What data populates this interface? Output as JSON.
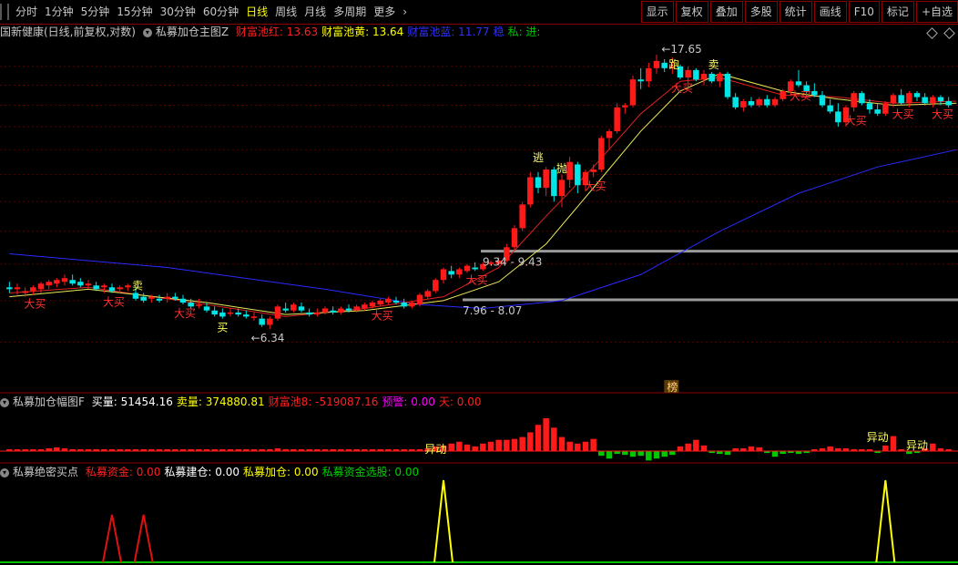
{
  "toolbar": {
    "periods": [
      "分时",
      "1分钟",
      "5分钟",
      "15分钟",
      "30分钟",
      "60分钟",
      "日线",
      "周线",
      "月线",
      "多周期",
      "更多"
    ],
    "active_period": "日线",
    "more_arrow": "›",
    "right_buttons": [
      "显示",
      "复权",
      "叠加",
      "多股",
      "统计",
      "画线",
      "F10",
      "标记",
      "+自选"
    ]
  },
  "main_panel": {
    "stock_title": "国新健康(日线,前复权,对数)",
    "indicator_name": "私募加仓主图Z",
    "legend": [
      {
        "label": "财富池红: 13.63",
        "color": "#ff2020"
      },
      {
        "label": "财富池黄: 13.64",
        "color": "#ffff00"
      },
      {
        "label": "财富池蓝: 11.77",
        "color": "#3030ff"
      },
      {
        "label": "稳",
        "color": "#3030ff"
      },
      {
        "label": "私: 进:",
        "color": "#00c000"
      }
    ]
  },
  "chart_data": {
    "type": "candlestick",
    "annotations": {
      "high_label": "17.65",
      "low_label": "6.34",
      "zone_upper": "9.34 - 9.43",
      "zone_lower": "7.96 - 8.07",
      "big_buy": "大买",
      "run": "跑",
      "sell": "卖",
      "escape": "逃",
      "throw": "抛",
      "rank": "榜",
      "buy_text": "买"
    },
    "candles": [
      [
        8.35,
        8.5,
        8.2,
        8.3
      ],
      [
        8.3,
        8.45,
        8.15,
        8.35
      ],
      [
        8.2,
        8.35,
        8.1,
        8.25
      ],
      [
        8.25,
        8.4,
        8.15,
        8.35
      ],
      [
        8.3,
        8.5,
        8.2,
        8.45
      ],
      [
        8.4,
        8.55,
        8.3,
        8.5
      ],
      [
        8.45,
        8.6,
        8.35,
        8.55
      ],
      [
        8.5,
        8.7,
        8.4,
        8.6
      ],
      [
        8.55,
        8.7,
        8.4,
        8.45
      ],
      [
        8.5,
        8.6,
        8.35,
        8.4
      ],
      [
        8.4,
        8.55,
        8.3,
        8.45
      ],
      [
        8.4,
        8.5,
        8.25,
        8.3
      ],
      [
        8.35,
        8.45,
        8.2,
        8.4
      ],
      [
        8.35,
        8.45,
        8.2,
        8.25
      ],
      [
        8.3,
        8.4,
        8.2,
        8.35
      ],
      [
        8.35,
        8.45,
        8.25,
        8.4
      ],
      [
        8.2,
        8.35,
        8.0,
        8.05
      ],
      [
        8.1,
        8.2,
        7.95,
        8.0
      ],
      [
        8.05,
        8.15,
        7.95,
        8.1
      ],
      [
        8.05,
        8.15,
        7.95,
        8.0
      ],
      [
        8.05,
        8.2,
        7.95,
        8.1
      ],
      [
        8.1,
        8.2,
        8.0,
        8.05
      ],
      [
        8.05,
        8.15,
        7.9,
        7.95
      ],
      [
        7.95,
        8.05,
        7.8,
        7.85
      ],
      [
        7.9,
        8.05,
        7.8,
        7.9
      ],
      [
        7.85,
        7.95,
        7.7,
        7.75
      ],
      [
        7.75,
        7.85,
        7.6,
        7.65
      ],
      [
        7.7,
        7.8,
        7.55,
        7.6
      ],
      [
        7.7,
        7.8,
        7.6,
        7.7
      ],
      [
        7.7,
        7.8,
        7.6,
        7.65
      ],
      [
        7.65,
        7.75,
        7.55,
        7.6
      ],
      [
        7.6,
        7.7,
        7.5,
        7.6
      ],
      [
        7.55,
        7.65,
        7.35,
        7.4
      ],
      [
        7.4,
        7.6,
        7.3,
        7.55
      ],
      [
        7.55,
        7.9,
        7.5,
        7.85
      ],
      [
        7.8,
        7.95,
        7.7,
        7.75
      ],
      [
        7.75,
        7.95,
        7.7,
        7.9
      ],
      [
        7.85,
        7.95,
        7.7,
        7.75
      ],
      [
        7.7,
        7.8,
        7.6,
        7.65
      ],
      [
        7.65,
        7.8,
        7.6,
        7.7
      ],
      [
        7.7,
        7.85,
        7.65,
        7.8
      ],
      [
        7.75,
        7.85,
        7.65,
        7.7
      ],
      [
        7.7,
        7.85,
        7.65,
        7.8
      ],
      [
        7.8,
        7.9,
        7.7,
        7.75
      ],
      [
        7.75,
        7.9,
        7.7,
        7.85
      ],
      [
        7.8,
        7.95,
        7.75,
        7.9
      ],
      [
        7.85,
        8.0,
        7.8,
        7.95
      ],
      [
        7.9,
        8.05,
        7.85,
        8.0
      ],
      [
        7.95,
        8.1,
        7.9,
        8.05
      ],
      [
        8.0,
        8.1,
        7.9,
        7.95
      ],
      [
        7.95,
        8.05,
        7.8,
        7.85
      ],
      [
        7.85,
        8.0,
        7.8,
        7.95
      ],
      [
        7.9,
        8.2,
        7.85,
        8.15
      ],
      [
        8.1,
        8.3,
        8.05,
        8.25
      ],
      [
        8.25,
        8.6,
        8.2,
        8.55
      ],
      [
        8.55,
        8.9,
        8.45,
        8.85
      ],
      [
        8.8,
        8.95,
        8.6,
        8.7
      ],
      [
        8.7,
        8.9,
        8.6,
        8.85
      ],
      [
        8.8,
        9.0,
        8.75,
        8.95
      ],
      [
        8.9,
        9.05,
        8.8,
        8.85
      ],
      [
        8.85,
        9.05,
        8.8,
        9.0
      ],
      [
        9.0,
        9.1,
        8.95,
        9.05
      ],
      [
        9.0,
        9.2,
        8.95,
        9.1
      ],
      [
        9.1,
        9.6,
        9.05,
        9.5
      ],
      [
        9.5,
        10.2,
        9.4,
        10.1
      ],
      [
        10.1,
        11.0,
        10.0,
        10.9
      ],
      [
        10.9,
        12.1,
        10.8,
        11.9
      ],
      [
        11.9,
        12.1,
        11.3,
        11.5
      ],
      [
        11.5,
        12.3,
        11.2,
        12.2
      ],
      [
        12.2,
        12.3,
        11.0,
        11.2
      ],
      [
        11.2,
        12.0,
        10.8,
        11.8
      ],
      [
        11.8,
        12.7,
        11.5,
        12.5
      ],
      [
        12.4,
        12.5,
        11.3,
        11.6
      ],
      [
        11.6,
        12.2,
        11.4,
        12.1
      ],
      [
        12.1,
        12.4,
        11.9,
        12.2
      ],
      [
        12.2,
        13.6,
        12.1,
        13.5
      ],
      [
        13.5,
        13.9,
        13.0,
        13.8
      ],
      [
        13.8,
        15.1,
        13.7,
        14.9
      ],
      [
        14.9,
        15.1,
        14.6,
        15.0
      ],
      [
        15.0,
        16.5,
        14.9,
        16.3
      ],
      [
        16.3,
        16.9,
        15.8,
        16.2
      ],
      [
        16.2,
        17.2,
        15.9,
        16.9
      ],
      [
        16.9,
        17.65,
        16.6,
        17.3
      ],
      [
        17.2,
        17.4,
        16.7,
        16.9
      ],
      [
        16.9,
        17.5,
        16.6,
        17.0
      ],
      [
        17.0,
        17.1,
        16.3,
        16.4
      ],
      [
        16.4,
        17.0,
        16.1,
        16.8
      ],
      [
        16.8,
        16.9,
        16.2,
        16.3
      ],
      [
        16.3,
        16.8,
        16.0,
        16.6
      ],
      [
        16.6,
        16.7,
        16.1,
        16.2
      ],
      [
        16.2,
        16.7,
        15.9,
        16.6
      ],
      [
        16.6,
        16.7,
        15.3,
        15.4
      ],
      [
        15.4,
        15.6,
        14.8,
        14.9
      ],
      [
        14.9,
        15.3,
        14.7,
        15.2
      ],
      [
        15.2,
        15.4,
        14.9,
        15.0
      ],
      [
        15.0,
        15.4,
        14.9,
        15.3
      ],
      [
        15.3,
        15.5,
        14.9,
        15.0
      ],
      [
        15.0,
        15.4,
        14.9,
        15.3
      ],
      [
        15.3,
        15.8,
        15.2,
        15.7
      ],
      [
        15.7,
        16.3,
        15.5,
        16.2
      ],
      [
        16.2,
        16.8,
        15.9,
        16.0
      ],
      [
        16.0,
        16.2,
        15.6,
        15.7
      ],
      [
        15.7,
        16.1,
        15.4,
        15.5
      ],
      [
        15.5,
        15.7,
        14.9,
        15.0
      ],
      [
        15.0,
        15.3,
        14.6,
        14.7
      ],
      [
        14.7,
        15.1,
        14.0,
        14.2
      ],
      [
        14.2,
        15.0,
        14.0,
        14.9
      ],
      [
        14.9,
        15.7,
        14.7,
        15.6
      ],
      [
        15.6,
        15.7,
        15.0,
        15.1
      ],
      [
        15.1,
        15.3,
        14.6,
        14.8
      ],
      [
        14.8,
        15.1,
        14.5,
        14.6
      ],
      [
        14.6,
        15.2,
        14.5,
        15.1
      ],
      [
        15.1,
        15.6,
        14.9,
        15.5
      ],
      [
        15.5,
        15.8,
        15.0,
        15.1
      ],
      [
        15.1,
        15.7,
        14.9,
        15.6
      ],
      [
        15.6,
        15.7,
        15.2,
        15.4
      ],
      [
        15.4,
        15.6,
        15.0,
        15.1
      ],
      [
        15.1,
        15.5,
        14.9,
        15.4
      ],
      [
        15.4,
        15.5,
        15.0,
        15.2
      ],
      [
        15.2,
        15.4,
        14.9,
        15.0
      ]
    ],
    "ma_blue_points": [
      [
        0,
        9.3
      ],
      [
        20,
        8.9
      ],
      [
        40,
        8.3
      ],
      [
        52,
        7.9
      ],
      [
        60,
        7.8
      ],
      [
        70,
        8.0
      ],
      [
        80,
        8.7
      ],
      [
        90,
        10.0
      ],
      [
        100,
        11.3
      ],
      [
        110,
        12.3
      ],
      [
        120,
        13.0
      ]
    ],
    "ma_red_points": [
      [
        0,
        8.2
      ],
      [
        10,
        8.35
      ],
      [
        25,
        7.9
      ],
      [
        35,
        7.6
      ],
      [
        45,
        7.8
      ],
      [
        55,
        8.1
      ],
      [
        62,
        8.9
      ],
      [
        68,
        10.5
      ],
      [
        74,
        12.3
      ],
      [
        80,
        14.6
      ],
      [
        85,
        16.2
      ],
      [
        90,
        16.4
      ],
      [
        98,
        15.5
      ],
      [
        105,
        15.4
      ],
      [
        112,
        15.1
      ],
      [
        120,
        15.2
      ]
    ],
    "ma_yellow_points": [
      [
        0,
        8.1
      ],
      [
        10,
        8.3
      ],
      [
        25,
        7.95
      ],
      [
        35,
        7.65
      ],
      [
        45,
        7.75
      ],
      [
        55,
        8.0
      ],
      [
        62,
        8.5
      ],
      [
        68,
        9.6
      ],
      [
        74,
        11.5
      ],
      [
        80,
        13.8
      ],
      [
        85,
        15.7
      ],
      [
        90,
        16.6
      ],
      [
        98,
        15.7
      ],
      [
        105,
        15.3
      ],
      [
        112,
        15.0
      ],
      [
        120,
        15.1
      ]
    ],
    "volume_panel": {
      "title": "私募加仓幅图F",
      "legend": [
        {
          "label": "买量: 51454.16",
          "color": "#ffffff"
        },
        {
          "label": "卖量: 374880.81",
          "color": "#ffff00"
        },
        {
          "label": "财富池8: -519087.16",
          "color": "#ff2020"
        },
        {
          "label": "预警: 0.00",
          "color": "#ff00ff"
        },
        {
          "label": "天: 0.00",
          "color": "#ff2020"
        }
      ],
      "marker": "异动",
      "values": [
        0.2,
        0.2,
        0.2,
        0.2,
        0.2,
        0.3,
        0.4,
        0.3,
        0.2,
        0.2,
        0.2,
        0.2,
        0.2,
        0.2,
        0.2,
        0.2,
        0.2,
        0.2,
        0.2,
        0.2,
        0.2,
        0.2,
        0.2,
        0.2,
        0.2,
        0.2,
        0.2,
        0.2,
        0.2,
        0.2,
        0.2,
        0.2,
        0.2,
        0.2,
        0.3,
        0.2,
        0.2,
        0.2,
        0.2,
        0.2,
        0.2,
        0.2,
        0.2,
        0.2,
        0.2,
        0.2,
        0.2,
        0.2,
        0.2,
        0.2,
        0.2,
        0.2,
        0.2,
        0.3,
        0.5,
        0.6,
        0.8,
        1.0,
        0.7,
        0.5,
        0.8,
        1.0,
        1.2,
        1.2,
        1.3,
        1.5,
        2.0,
        2.8,
        3.5,
        2.5,
        1.5,
        1.0,
        0.8,
        1.0,
        1.3,
        -0.5,
        -0.8,
        -0.3,
        -0.4,
        -0.6,
        -0.5,
        -1.0,
        -0.8,
        -0.6,
        -0.4,
        0.5,
        0.8,
        1.2,
        0.6,
        -0.2,
        -0.3,
        -0.4,
        0.3,
        0.3,
        0.5,
        0.4,
        -0.2,
        -0.6,
        -0.3,
        -0.2,
        -0.3,
        -0.2,
        0.2,
        0.3,
        0.5,
        0.3,
        0.3,
        0.2,
        0.2,
        0.2,
        -0.2,
        0.6,
        1.6,
        0.2,
        -0.3,
        -0.2,
        0.3,
        0.8,
        0.3,
        0.2
      ]
    },
    "signal_panel": {
      "title": "私募绝密买点",
      "legend": [
        {
          "label": "私募资金: 0.00",
          "color": "#ff2020"
        },
        {
          "label": "私募建仓: 0.00",
          "color": "#ffffff"
        },
        {
          "label": "私募加仓: 0.00",
          "color": "#ffff00"
        },
        {
          "label": "私募资金选股: 0.00",
          "color": "#00d000"
        }
      ],
      "red_spikes": [
        13,
        17
      ],
      "yellow_spikes": [
        55,
        111
      ]
    }
  }
}
